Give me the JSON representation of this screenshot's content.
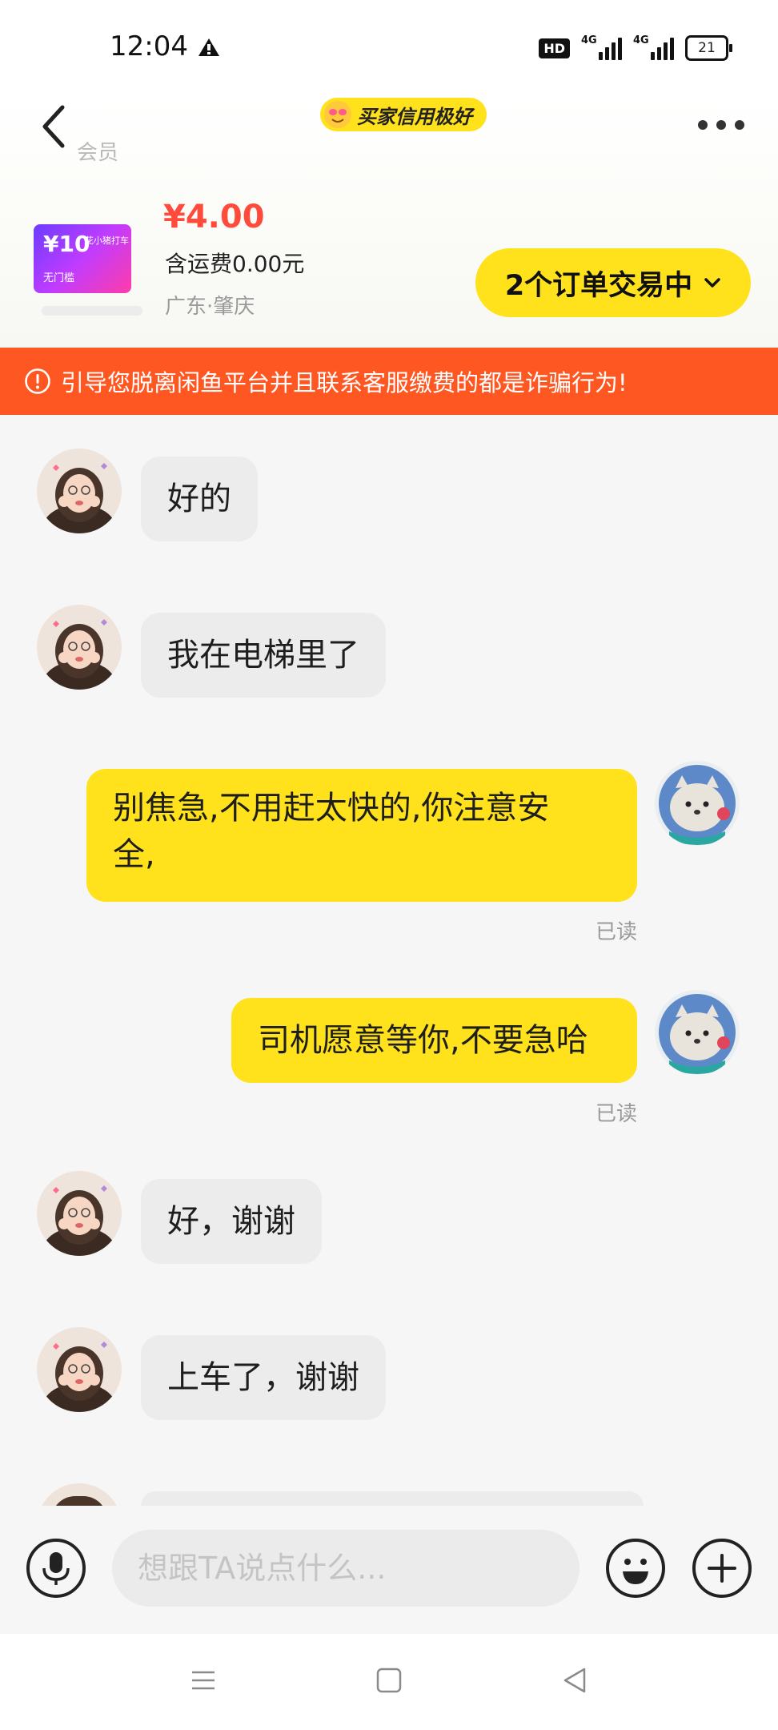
{
  "status_bar": {
    "time": "12:04",
    "hd": "HD",
    "network_1": "4G",
    "network_2": "4G",
    "battery": "21"
  },
  "header": {
    "member_text": "会员",
    "credit_badge": "买家信用极好"
  },
  "product": {
    "image_value": "¥10",
    "image_small_text": "花小猪打车",
    "image_sub_text": "无门槛",
    "price": "¥4.00",
    "shipping": "含运费0.00元",
    "location": "广东·肇庆",
    "order_button": "2个订单交易中"
  },
  "warning": {
    "text": "引导您脱离闲鱼平台并且联系客服缴费的都是诈骗行为!"
  },
  "messages": [
    {
      "side": "left",
      "text": "好的"
    },
    {
      "side": "left",
      "text": "我在电梯里了"
    },
    {
      "side": "right",
      "line1": "别焦急,不用赶太快的,你注意安",
      "line2": "全,",
      "status": "已读"
    },
    {
      "side": "right",
      "text": "司机愿意等你,不要急哈",
      "status": "已读"
    },
    {
      "side": "left",
      "text": "好，谢谢"
    },
    {
      "side": "left",
      "text": "上车了，谢谢"
    }
  ],
  "input": {
    "placeholder": "想跟TA说点什么..."
  },
  "colors": {
    "accent_yellow": "#ffe21c",
    "warning_orange": "#ff5722",
    "price_red": "#ff4b3c"
  },
  "icons": [
    "back-arrow-icon",
    "more-icon",
    "microphone-icon",
    "emoji-icon",
    "plus-icon",
    "menu-icon",
    "home-icon",
    "back-triangle-icon"
  ]
}
